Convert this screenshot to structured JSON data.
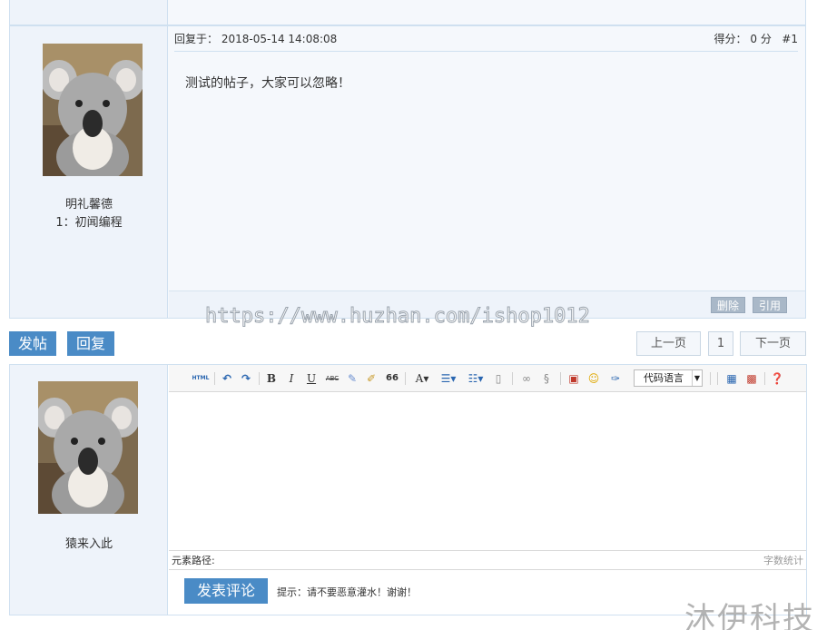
{
  "post": {
    "reply_label": "回复于：",
    "reply_time": "2018-05-14 14:08:08",
    "score_label": "得分：",
    "score_value": "0 分",
    "floor": "#1",
    "content": "测试的帖子，大家可以忽略！",
    "user": {
      "name": "明礼馨德",
      "level": "1：初闻编程"
    },
    "actions": {
      "delete": "删除",
      "quote": "引用"
    }
  },
  "watermark_url": "https://www.huzhan.com/ishop1012",
  "action_bar": {
    "post_label": "发帖",
    "reply_label": "回复",
    "pager": {
      "prev": "上一页",
      "page": "1",
      "next": "下一页"
    }
  },
  "editor": {
    "user": {
      "name": "猿来入此"
    },
    "toolbar": {
      "html": "HTML",
      "bold": "B",
      "italic": "I",
      "underline": "U",
      "strike": "ABC",
      "quote": "66",
      "font_color": "A",
      "code_lang": "代码语言"
    },
    "path_label": "元素路径:",
    "word_count": "字数统计",
    "submit_label": "发表评论",
    "hint": "提示：请不要恶意灌水！谢谢！"
  },
  "watermark_corner": "沐伊科技",
  "colors": {
    "accent": "#4a8bc6",
    "panel": "#eef3fa",
    "border": "#cfe0f0"
  }
}
